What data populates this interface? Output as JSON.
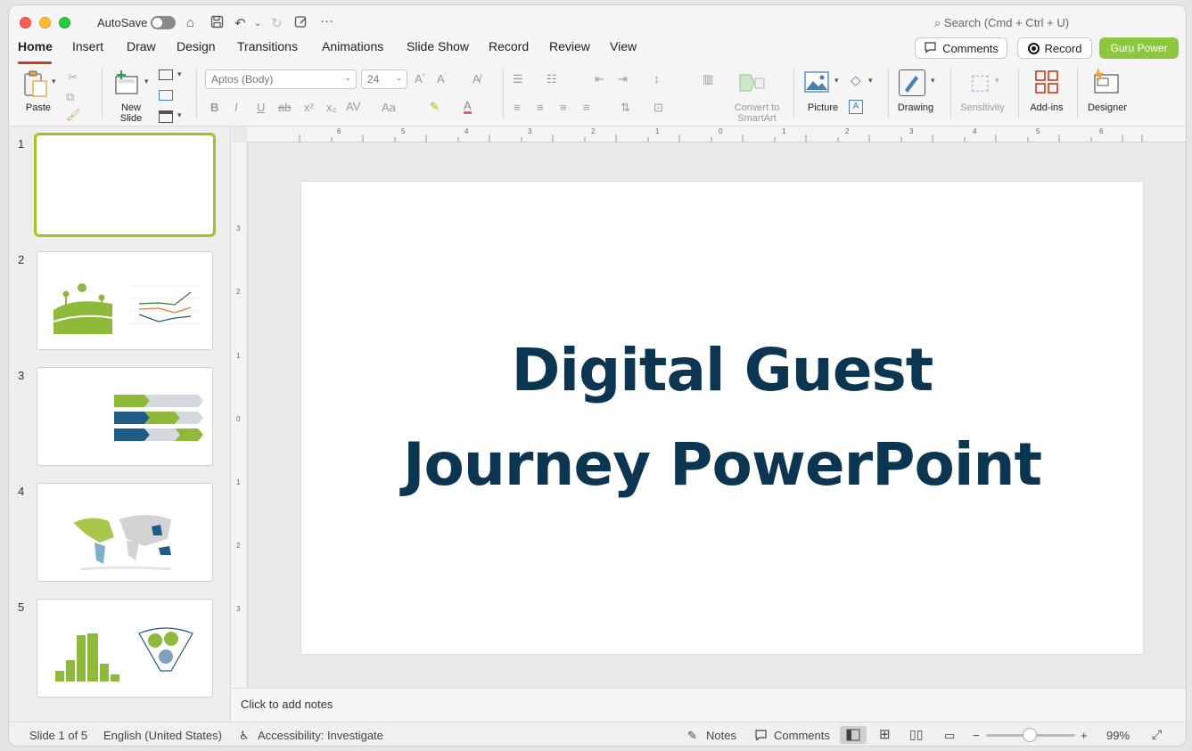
{
  "titlebar": {
    "autosave_label": "AutoSave",
    "search_placeholder": "Search (Cmd + Ctrl + U)"
  },
  "tabs": [
    {
      "label": "Home",
      "active": true
    },
    {
      "label": "Insert"
    },
    {
      "label": "Draw"
    },
    {
      "label": "Design"
    },
    {
      "label": "Transitions"
    },
    {
      "label": "Animations"
    },
    {
      "label": "Slide Show"
    },
    {
      "label": "Record"
    },
    {
      "label": "Review"
    },
    {
      "label": "View"
    }
  ],
  "top_buttons": {
    "comments": "Comments",
    "record": "Record",
    "guru": "Guru Power"
  },
  "ribbon": {
    "paste": "Paste",
    "new_slide": "New\nSlide",
    "font_name": "Aptos (Body)",
    "font_size": "24",
    "convert_smartart": "Convert to\nSmartArt",
    "picture": "Picture",
    "drawing": "Drawing",
    "sensitivity": "Sensitivity",
    "addins": "Add-ins",
    "designer": "Designer"
  },
  "ruler": {
    "h_labels": [
      "6",
      "5",
      "4",
      "3",
      "2",
      "1",
      "0",
      "1",
      "2",
      "3",
      "4",
      "5",
      "6"
    ],
    "v_labels": [
      "3",
      "2",
      "1",
      "0",
      "1",
      "2",
      "3"
    ]
  },
  "thumbnails": [
    {
      "number": "1",
      "selected": true
    },
    {
      "number": "2"
    },
    {
      "number": "3"
    },
    {
      "number": "4"
    },
    {
      "number": "5"
    }
  ],
  "slide": {
    "title_line1": "Digital Guest",
    "title_line2": "Journey PowerPoint",
    "title_color": "#0b3550"
  },
  "notes_placeholder": "Click to add notes",
  "status": {
    "slide_count": "Slide 1 of 5",
    "language": "English (United States)",
    "accessibility": "Accessibility: Investigate",
    "notes": "Notes",
    "comments": "Comments",
    "zoom": "99%"
  },
  "colors": {
    "accent_green": "#8dc63f",
    "tab_underline": "#c43e1c",
    "navy": "#0b3550"
  }
}
